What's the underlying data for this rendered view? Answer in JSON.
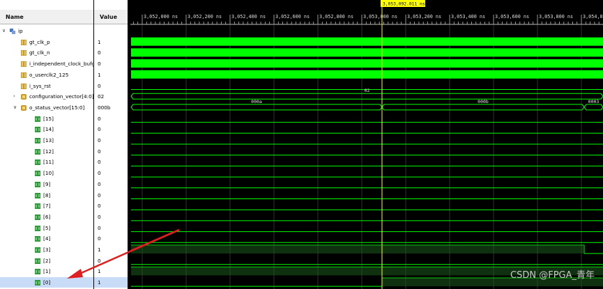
{
  "names_header": "Name",
  "values_header": "Value",
  "time_ticks": [
    "3,052,000 ns",
    "3,052,200 ns",
    "3,052,400 ns",
    "3,052,600 ns",
    "3,052,800 ns",
    "3,053,000 ns",
    "3,053,200 ns",
    "3,053,400 ns",
    "3,053,600 ns",
    "3,053,800 ns",
    "3,054,00"
  ],
  "cursor_label": "3,053,092.011 ns",
  "signals": [
    {
      "name": "ip",
      "value": "",
      "indent": 0,
      "expander": "expanded",
      "icon": "scope-icon"
    },
    {
      "name": "gt_clk_p",
      "value": "1",
      "indent": 1,
      "icon": "logic-signal-icon"
    },
    {
      "name": "gt_clk_n",
      "value": "0",
      "indent": 1,
      "icon": "logic-signal-icon"
    },
    {
      "name": "i_independent_clock_bufg",
      "value": "0",
      "indent": 1,
      "icon": "logic-signal-icon"
    },
    {
      "name": "o_userclk2_125",
      "value": "1",
      "indent": 1,
      "icon": "logic-signal-icon"
    },
    {
      "name": "i_sys_rst",
      "value": "0",
      "indent": 1,
      "icon": "logic-signal-icon"
    },
    {
      "name": "configuration_vector[4:0]",
      "value": "02",
      "indent": 1,
      "expander": "collapsed",
      "icon": "bus-icon"
    },
    {
      "name": "o_status_vector[15:0]",
      "value": "000b",
      "indent": 1,
      "expander": "expanded",
      "icon": "bus-icon"
    },
    {
      "name": "[15]",
      "value": "0",
      "indent": 2,
      "icon": "bit-icon"
    },
    {
      "name": "[14]",
      "value": "0",
      "indent": 2,
      "icon": "bit-icon"
    },
    {
      "name": "[13]",
      "value": "0",
      "indent": 2,
      "icon": "bit-icon"
    },
    {
      "name": "[12]",
      "value": "0",
      "indent": 2,
      "icon": "bit-icon"
    },
    {
      "name": "[11]",
      "value": "0",
      "indent": 2,
      "icon": "bit-icon"
    },
    {
      "name": "[10]",
      "value": "0",
      "indent": 2,
      "icon": "bit-icon"
    },
    {
      "name": "[9]",
      "value": "0",
      "indent": 2,
      "icon": "bit-icon"
    },
    {
      "name": "[8]",
      "value": "0",
      "indent": 2,
      "icon": "bit-icon"
    },
    {
      "name": "[7]",
      "value": "0",
      "indent": 2,
      "icon": "bit-icon"
    },
    {
      "name": "[6]",
      "value": "0",
      "indent": 2,
      "icon": "bit-icon"
    },
    {
      "name": "[5]",
      "value": "0",
      "indent": 2,
      "icon": "bit-icon"
    },
    {
      "name": "[4]",
      "value": "0",
      "indent": 2,
      "icon": "bit-icon"
    },
    {
      "name": "[3]",
      "value": "1",
      "indent": 2,
      "icon": "bit-icon"
    },
    {
      "name": "[2]",
      "value": "0",
      "indent": 2,
      "icon": "bit-icon"
    },
    {
      "name": "[1]",
      "value": "1",
      "indent": 2,
      "icon": "bit-icon"
    },
    {
      "name": "[0]",
      "value": "1",
      "indent": 2,
      "icon": "bit-icon",
      "selected": true
    }
  ],
  "bus_labels": {
    "configuration_vector": [
      "02"
    ],
    "o_status_vector": [
      "000a",
      "000b",
      "0003"
    ]
  },
  "watermark": "CSDN @FPGA_青年",
  "colors": {
    "background": "#000000",
    "signal": "#00ff00",
    "grid": "#2f2f2f",
    "cursor": "#ffff00",
    "panel": "#ffffff",
    "selected_row": "#c8dcf8",
    "annotation_arrow": "#e02020"
  }
}
